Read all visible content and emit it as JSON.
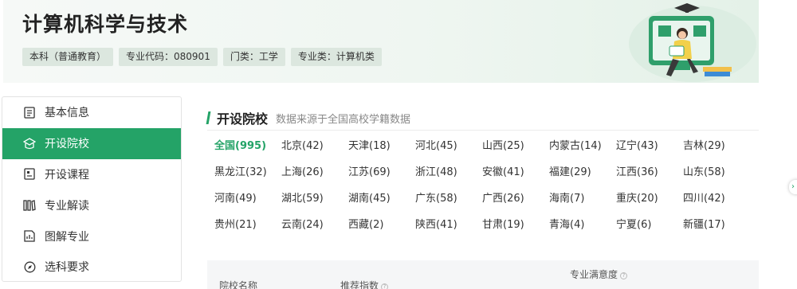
{
  "header": {
    "title": "计算机科学与技术",
    "tags": [
      "本科（普通教育）",
      "专业代码：080901",
      "门类：工学",
      "专业类：计算机类"
    ]
  },
  "sidebar": {
    "items": [
      {
        "label": "基本信息",
        "icon": "document-icon"
      },
      {
        "label": "开设院校",
        "icon": "school-icon"
      },
      {
        "label": "开设课程",
        "icon": "course-icon"
      },
      {
        "label": "专业解读",
        "icon": "books-icon"
      },
      {
        "label": "图解专业",
        "icon": "chart-doc-icon"
      },
      {
        "label": "选科要求",
        "icon": "compass-icon"
      }
    ],
    "active_index": 1
  },
  "section": {
    "title": "开设院校",
    "subtitle": "数据来源于全国高校学籍数据"
  },
  "regions": [
    "全国(995)",
    "北京(42)",
    "天津(18)",
    "河北(45)",
    "山西(25)",
    "内蒙古(14)",
    "辽宁(43)",
    "吉林(29)",
    "黑龙江(32)",
    "上海(26)",
    "江苏(69)",
    "浙江(48)",
    "安徽(41)",
    "福建(29)",
    "江西(36)",
    "山东(58)",
    "河南(49)",
    "湖北(59)",
    "湖南(45)",
    "广东(58)",
    "广西(26)",
    "海南(7)",
    "重庆(20)",
    "四川(42)",
    "贵州(21)",
    "云南(24)",
    "西藏(2)",
    "陕西(41)",
    "甘肃(19)",
    "青海(4)",
    "宁夏(6)",
    "新疆(17)"
  ],
  "table": {
    "col_school": "院校名称",
    "col_recommend": "推荐指数",
    "col_satisfaction": "专业满意度"
  },
  "colors": {
    "accent": "#24a367",
    "header_bg": "#eff6f1"
  }
}
